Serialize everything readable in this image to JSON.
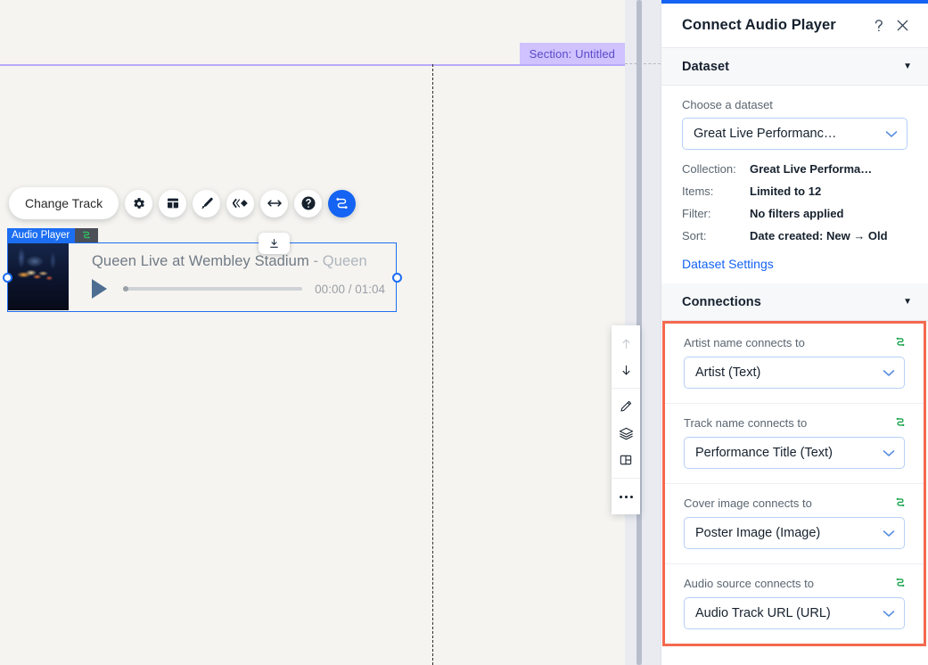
{
  "canvas": {
    "section_tag": "Section: Untitled",
    "toolbar": {
      "change_track_label": "Change Track",
      "buttons": [
        {
          "name": "gear-icon",
          "label": "Settings"
        },
        {
          "name": "layout-icon",
          "label": "Layout"
        },
        {
          "name": "brush-icon",
          "label": "Design"
        },
        {
          "name": "animation-icon",
          "label": "Animation"
        },
        {
          "name": "stretch-icon",
          "label": "Stretch"
        },
        {
          "name": "help-icon",
          "label": "Help"
        },
        {
          "name": "connect-icon",
          "label": "Connect to Data"
        }
      ]
    },
    "widget": {
      "badge_label": "Audio Player",
      "badge_icon": "connect-icon",
      "track_title": "Queen Live at Wembley Stadium",
      "separator": "-",
      "artist": "Queen",
      "time_display": "00:00 / 01:04",
      "progress_percent": 0,
      "download_icon": "download-icon",
      "play_icon": "play-icon"
    },
    "side_tools": [
      {
        "name": "move-up-icon",
        "label": "Move up",
        "disabled": true
      },
      {
        "name": "move-down-icon",
        "label": "Move down",
        "disabled": false
      },
      {
        "name": "pencil-icon",
        "label": "Edit",
        "disabled": false
      },
      {
        "name": "layers-icon",
        "label": "Layers",
        "disabled": false
      },
      {
        "name": "layout-split-icon",
        "label": "Layout",
        "disabled": false
      },
      {
        "name": "more-icon",
        "label": "More",
        "disabled": false
      }
    ]
  },
  "panel": {
    "title": "Connect Audio Player",
    "help_icon": "question-mark-icon",
    "close_icon": "close-icon",
    "dataset": {
      "section_title": "Dataset",
      "choose_label": "Choose a dataset",
      "selected_dataset": "Great Live Performanc…",
      "info": [
        {
          "key": "Collection:",
          "value": "Great Live Performa…"
        },
        {
          "key": "Items:",
          "value": "Limited to 12"
        },
        {
          "key": "Filter:",
          "value": "No filters applied"
        },
        {
          "key": "Sort:",
          "value": "Date created: New → Old"
        }
      ],
      "settings_link": "Dataset Settings"
    },
    "connections": {
      "section_title": "Connections",
      "rows": [
        {
          "label": "Artist name connects to",
          "value": "Artist (Text)"
        },
        {
          "label": "Track name connects to",
          "value": "Performance Title (Text)"
        },
        {
          "label": "Cover image connects to",
          "value": "Poster Image (Image)"
        },
        {
          "label": "Audio source connects to",
          "value": "Audio Track URL (URL)"
        }
      ]
    }
  },
  "colors": {
    "accent_blue": "#1463f3",
    "highlight_orange": "#f4694f",
    "connect_green": "#16a34a",
    "section_purple": "#cfc2ff"
  }
}
